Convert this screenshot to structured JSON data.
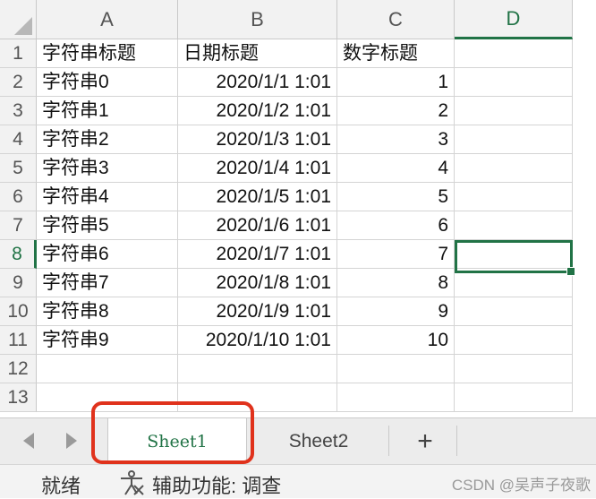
{
  "sheet": {
    "columns": [
      "A",
      "B",
      "C",
      "D"
    ],
    "active_column": "D",
    "row_numbers": [
      "1",
      "2",
      "3",
      "4",
      "5",
      "6",
      "7",
      "8",
      "9",
      "10",
      "11",
      "12",
      "13"
    ],
    "active_row": "8",
    "rows": [
      [
        "字符串标题",
        "日期标题",
        "数字标题",
        ""
      ],
      [
        "字符串0",
        "2020/1/1 1:01",
        "1",
        ""
      ],
      [
        "字符串1",
        "2020/1/2 1:01",
        "2",
        ""
      ],
      [
        "字符串2",
        "2020/1/3 1:01",
        "3",
        ""
      ],
      [
        "字符串3",
        "2020/1/4 1:01",
        "4",
        ""
      ],
      [
        "字符串4",
        "2020/1/5 1:01",
        "5",
        ""
      ],
      [
        "字符串5",
        "2020/1/6 1:01",
        "6",
        ""
      ],
      [
        "字符串6",
        "2020/1/7 1:01",
        "7",
        ""
      ],
      [
        "字符串7",
        "2020/1/8 1:01",
        "8",
        ""
      ],
      [
        "字符串8",
        "2020/1/9 1:01",
        "9",
        ""
      ],
      [
        "字符串9",
        "2020/1/10 1:01",
        "10",
        ""
      ],
      [
        "",
        "",
        "",
        ""
      ],
      [
        "",
        "",
        "",
        ""
      ]
    ],
    "selected_cell": "D8"
  },
  "tabs": {
    "items": [
      "Sheet1",
      "Sheet2"
    ],
    "active": "Sheet1",
    "add_label": "+"
  },
  "status": {
    "ready": "就绪",
    "accessibility": "辅助功能: 调查"
  },
  "watermark": "CSDN @吴声子夜歌",
  "colors": {
    "accent": "#217346",
    "highlight": "#e0321c"
  },
  "icons": [
    "nav-left-icon",
    "nav-right-icon",
    "add-sheet-icon",
    "accessibility-icon"
  ]
}
